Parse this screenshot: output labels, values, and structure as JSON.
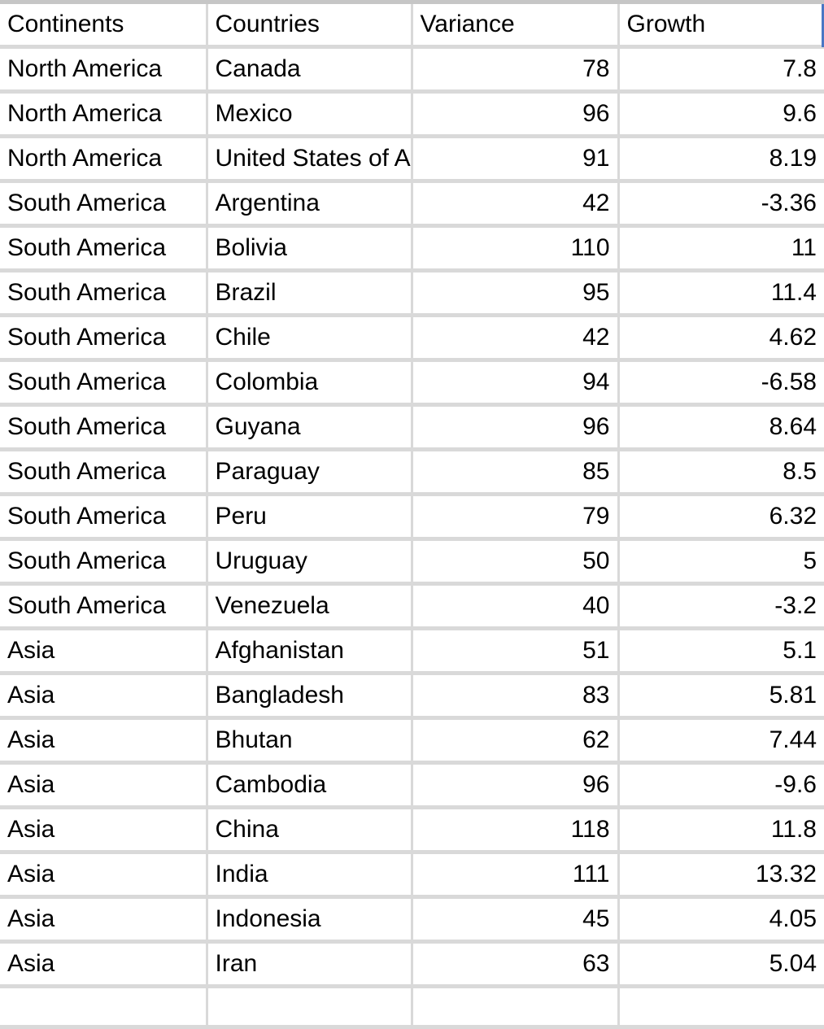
{
  "table": {
    "columns": [
      {
        "key": "continent",
        "label": "Continents",
        "align": "left"
      },
      {
        "key": "country",
        "label": "Countries",
        "align": "left"
      },
      {
        "key": "variance",
        "label": "Variance",
        "align": "right"
      },
      {
        "key": "growth",
        "label": "Growth",
        "align": "right"
      }
    ],
    "header": {
      "continents": "Continents",
      "countries": "Countries",
      "variance": "Variance",
      "growth": "Growth"
    },
    "rows": [
      {
        "continent": "North America",
        "country": "Canada",
        "variance": "78",
        "growth": "7.8"
      },
      {
        "continent": "North America",
        "country": "Mexico",
        "variance": "96",
        "growth": "9.6"
      },
      {
        "continent": "North America",
        "country": "United States of America",
        "variance": "91",
        "growth": "8.19"
      },
      {
        "continent": "South America",
        "country": "Argentina",
        "variance": "42",
        "growth": "-3.36"
      },
      {
        "continent": "South America",
        "country": "Bolivia",
        "variance": "110",
        "growth": "11"
      },
      {
        "continent": "South America",
        "country": "Brazil",
        "variance": "95",
        "growth": "11.4"
      },
      {
        "continent": "South America",
        "country": "Chile",
        "variance": "42",
        "growth": "4.62"
      },
      {
        "continent": "South America",
        "country": "Colombia",
        "variance": "94",
        "growth": "-6.58"
      },
      {
        "continent": "South America",
        "country": "Guyana",
        "variance": "96",
        "growth": "8.64"
      },
      {
        "continent": "South America",
        "country": "Paraguay",
        "variance": "85",
        "growth": "8.5"
      },
      {
        "continent": "South America",
        "country": "Peru",
        "variance": "79",
        "growth": "6.32"
      },
      {
        "continent": "South America",
        "country": "Uruguay",
        "variance": "50",
        "growth": "5"
      },
      {
        "continent": "South America",
        "country": "Venezuela",
        "variance": "40",
        "growth": "-3.2"
      },
      {
        "continent": "Asia",
        "country": "Afghanistan",
        "variance": "51",
        "growth": "5.1"
      },
      {
        "continent": "Asia",
        "country": "Bangladesh",
        "variance": "83",
        "growth": "5.81"
      },
      {
        "continent": "Asia",
        "country": "Bhutan",
        "variance": "62",
        "growth": "7.44"
      },
      {
        "continent": "Asia",
        "country": "Cambodia",
        "variance": "96",
        "growth": "-9.6"
      },
      {
        "continent": "Asia",
        "country": "China",
        "variance": "118",
        "growth": "11.8"
      },
      {
        "continent": "Asia",
        "country": "India",
        "variance": "111",
        "growth": "13.32"
      },
      {
        "continent": "Asia",
        "country": "Indonesia",
        "variance": "45",
        "growth": "4.05"
      },
      {
        "continent": "Asia",
        "country": "Iran",
        "variance": "63",
        "growth": "5.04"
      },
      {
        "continent": "",
        "country": "",
        "variance": "",
        "growth": ""
      }
    ]
  },
  "colors": {
    "gridline": "#d9d9d9",
    "top_border": "#c6c6c6",
    "selection": "#4a77c4",
    "text": "#000000",
    "cell_background": "#ffffff"
  }
}
